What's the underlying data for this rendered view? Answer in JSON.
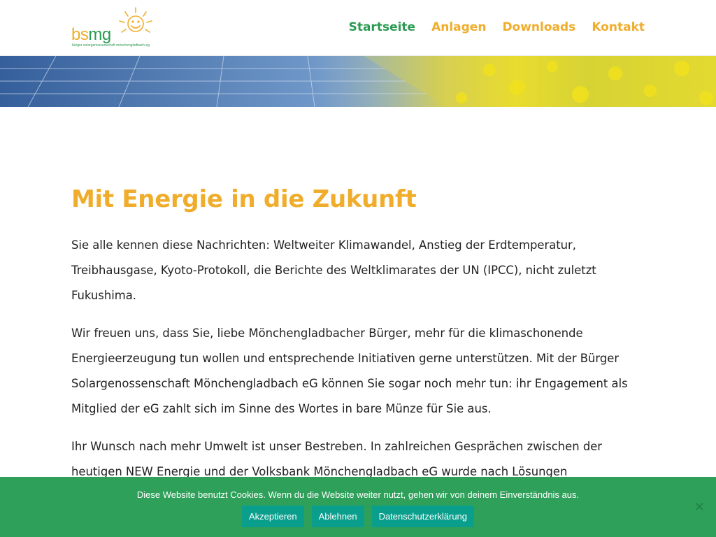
{
  "header": {
    "logo": {
      "text_part1": "bs",
      "text_part2": "mg",
      "subtitle": "bürger solargenossenschaft mönchengladbach eg"
    },
    "nav": [
      {
        "label": "Startseite",
        "active": true
      },
      {
        "label": "Anlagen",
        "active": false
      },
      {
        "label": "Downloads",
        "active": false
      },
      {
        "label": "Kontakt",
        "active": false
      }
    ]
  },
  "main": {
    "title": "Mit Energie in die Zukunft",
    "paragraphs": [
      "Sie alle kennen diese Nachrichten: Weltweiter Klimawandel, Anstieg der Erdtemperatur, Treibhausgase, Kyoto-Protokoll, die Berichte des Weltklimarates der UN (IPCC), nicht zuletzt Fukushima.",
      "Wir freuen uns, dass Sie, liebe Mönchengladbacher Bürger, mehr für die klimaschonende Energieerzeugung tun wollen und entsprechende Initiativen gerne unterstützen. Mit der Bürger Solargenossenschaft Mönchengladbach eG können Sie sogar noch mehr tun: ihr Engagement als Mitglied der eG zahlt sich im Sinne des Wortes in bare Münze für Sie aus.",
      "Ihr Wunsch nach mehr Umwelt ist unser Bestreben. In zahlreichen Gesprächen zwischen der heutigen NEW Energie und der Volksbank Mönchengladbach eG wurde nach Lösungen"
    ]
  },
  "cookie_banner": {
    "text": "Diese Website benutzt Cookies. Wenn du die Website weiter nutzt, gehen wir von deinem Einverständnis aus.",
    "accept_label": "Akzeptieren",
    "decline_label": "Ablehnen",
    "privacy_label": "Datenschutzerklärung",
    "close_icon": "×"
  },
  "colors": {
    "accent_orange": "#f0ad2c",
    "accent_green": "#2b9a52",
    "cookie_bg": "#2ea05a",
    "cookie_button": "#0a9f8c"
  }
}
